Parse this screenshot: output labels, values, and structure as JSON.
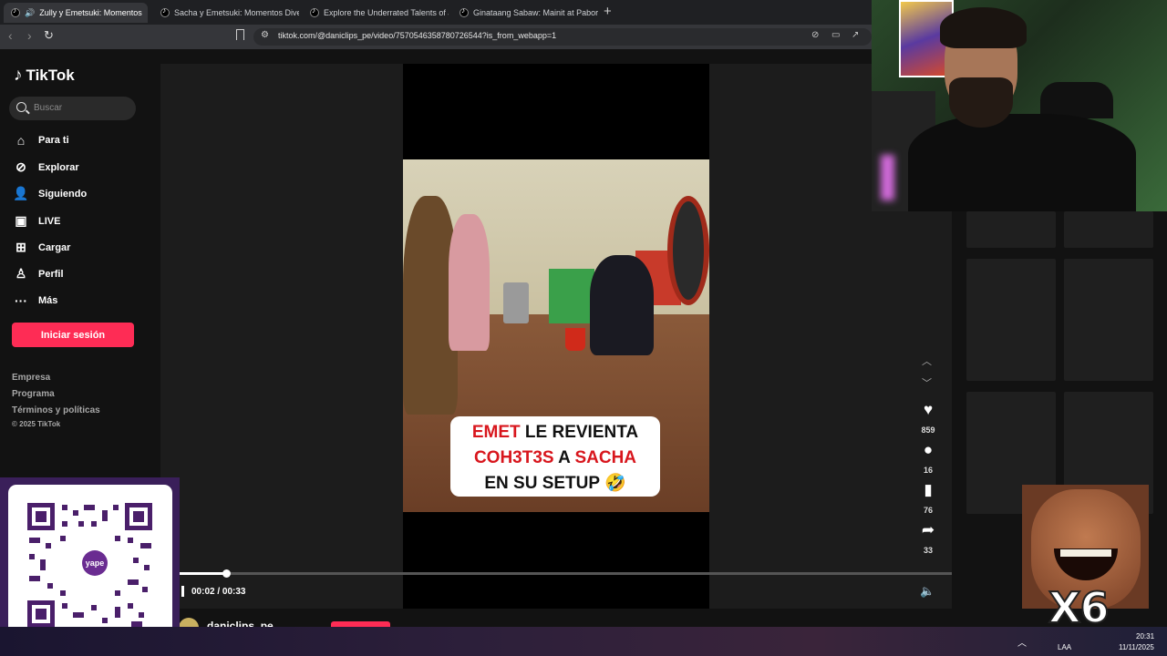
{
  "browser": {
    "tabs": [
      {
        "title": "Zully y Emetsuki: Momentos",
        "active": true
      },
      {
        "title": "Sacha y Emetsuki: Momentos Diverti",
        "active": false
      },
      {
        "title": "Explore the Underrated Talents of Jay",
        "active": false
      },
      {
        "title": "Ginataang Sabaw: Mainit at Paborito",
        "active": false
      }
    ],
    "new_tab": "+",
    "close": "✕",
    "url": "tiktok.com/@daniclips_pe/video/7570546358780726544?is_from_webapp=1"
  },
  "sidebar": {
    "logo": "TikTok",
    "search_placeholder": "Buscar",
    "nav": [
      {
        "label": "Para ti",
        "icon": "home-icon"
      },
      {
        "label": "Explorar",
        "icon": "compass-icon"
      },
      {
        "label": "Siguiendo",
        "icon": "following-icon"
      },
      {
        "label": "LIVE",
        "icon": "live-icon"
      },
      {
        "label": "Cargar",
        "icon": "upload-icon"
      },
      {
        "label": "Perfil",
        "icon": "profile-icon"
      },
      {
        "label": "Más",
        "icon": "more-icon"
      }
    ],
    "login_button": "Iniciar sesión",
    "footer_links": [
      "Empresa",
      "Programa",
      "Términos y políticas"
    ],
    "copyright": "© 2025 TikTok"
  },
  "video": {
    "caption_line1_red": "EMET",
    "caption_line1_rest": " LE REVIENTA",
    "caption_line2_red1": "COH3T3S",
    "caption_line2_mid": " A ",
    "caption_line2_red2": "SACHA",
    "caption_line3": "EN SU SETUP 🤣",
    "time": "00:02 / 00:33",
    "progress": 0.06,
    "author": "daniclips_pe"
  },
  "actions": {
    "likes": "859",
    "comments": "16",
    "saves": "76",
    "shares": "33"
  },
  "overlays": {
    "qr_brand": "yape",
    "meme_text": "X6"
  },
  "taskbar": {
    "lang": "LAA",
    "time": "20:31",
    "date": "11/11/2025"
  }
}
